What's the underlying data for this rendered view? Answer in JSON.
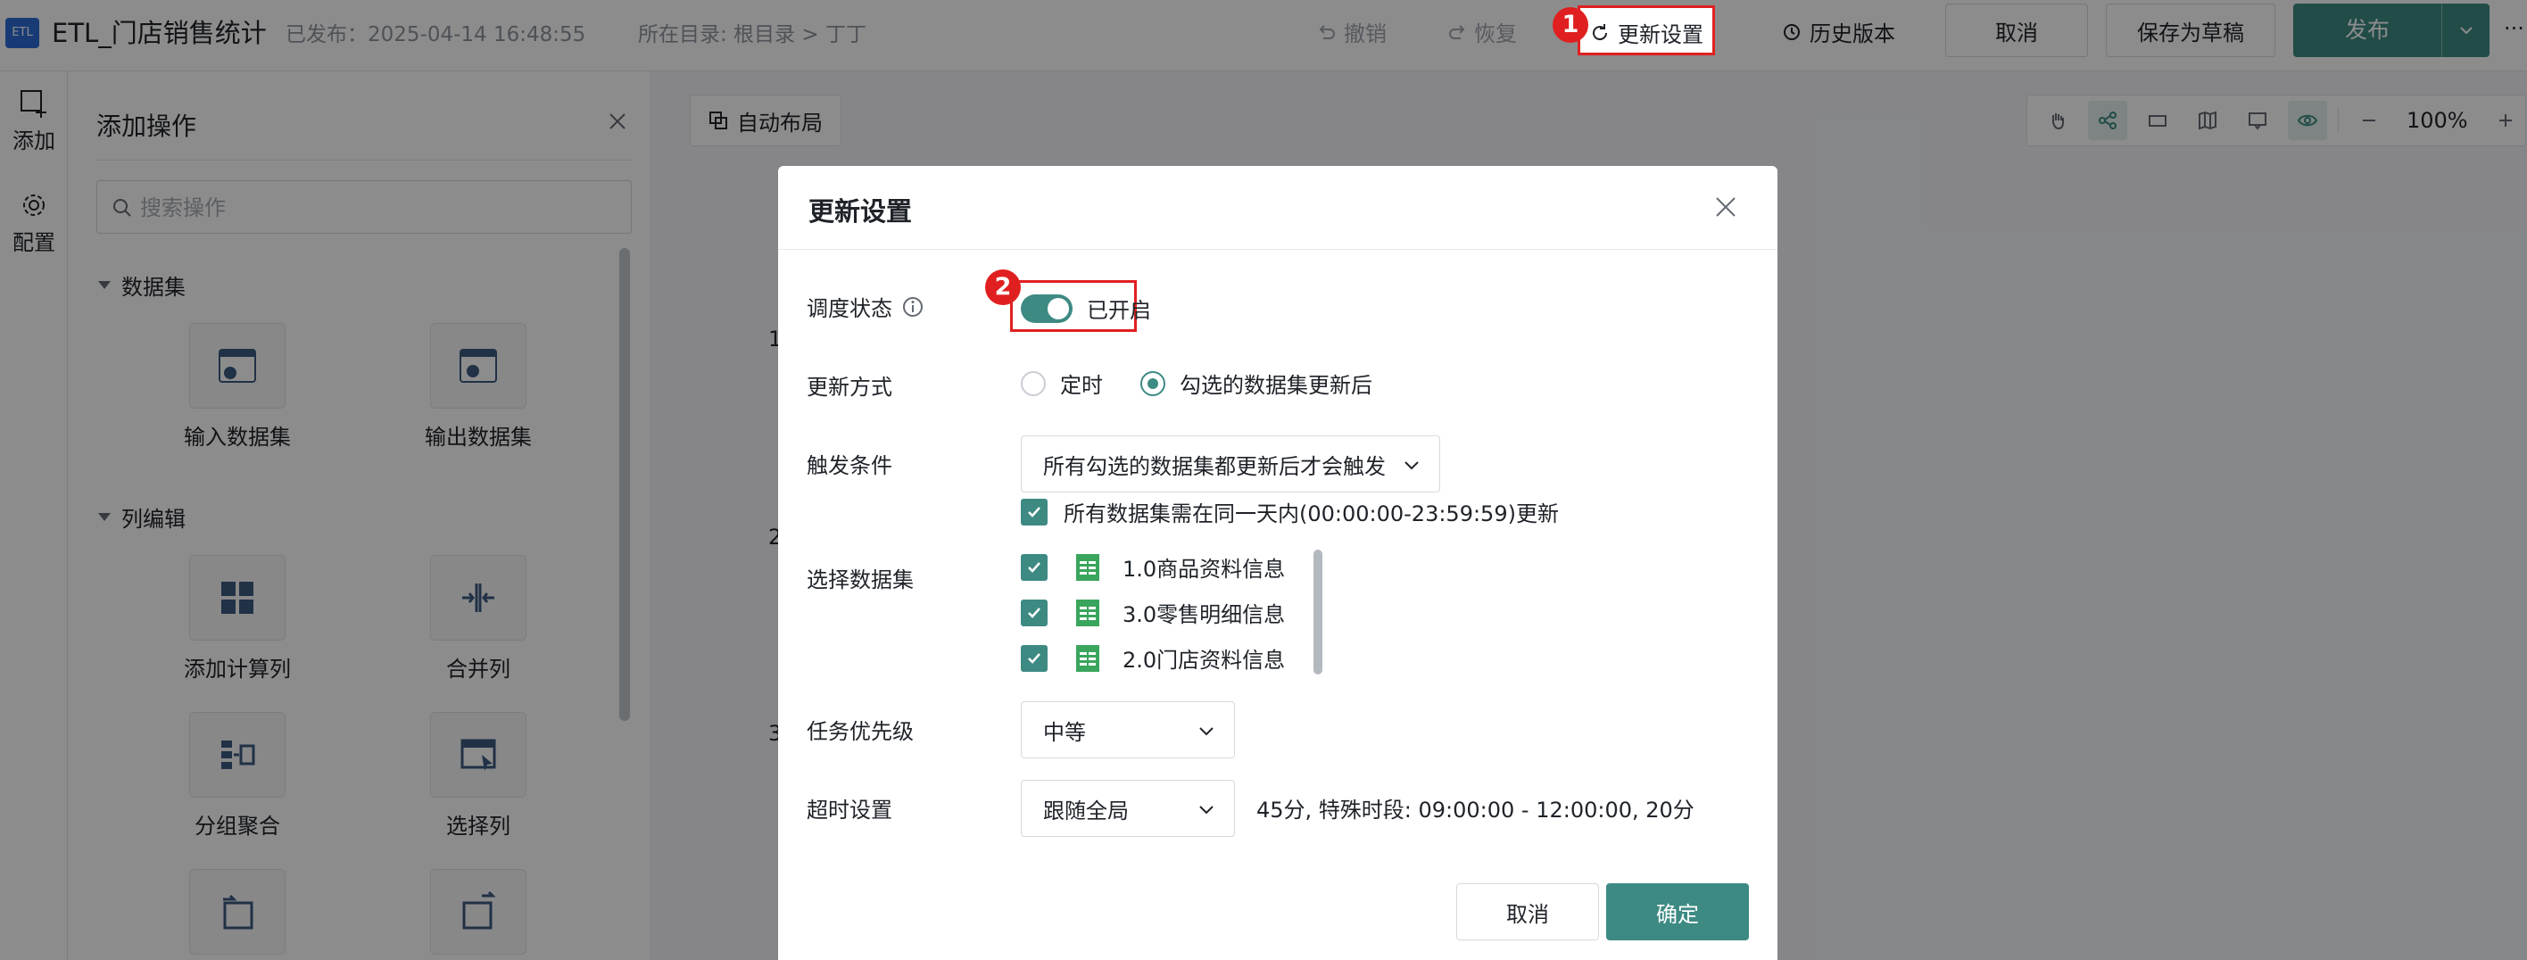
{
  "topbar": {
    "logo_text": "ETL",
    "title": "ETL_门店销售统计",
    "publish_info": "已发布：2025-04-14 16:48:55",
    "directory": "所在目录: 根目录 > 丁丁",
    "undo": "撤销",
    "redo": "恢复",
    "update_settings": "更新设置",
    "history": "历史版本",
    "cancel": "取消",
    "save_draft": "保存为草稿",
    "publish": "发布",
    "more": "···"
  },
  "callouts": [
    "1",
    "2"
  ],
  "rail": {
    "add": "添加",
    "config": "配置"
  },
  "ops_panel": {
    "title": "添加操作",
    "search_placeholder": "搜索操作",
    "sections": [
      {
        "title": "数据集",
        "items": [
          "输入数据集",
          "输出数据集"
        ]
      },
      {
        "title": "列编辑",
        "items": [
          "添加计算列",
          "合并列",
          "分组聚合",
          "选择列"
        ]
      }
    ]
  },
  "canvas": {
    "auto_layout": "自动布局",
    "zoom": "100%",
    "row_numbers": [
      "1",
      "2",
      "3"
    ]
  },
  "modal": {
    "title": "更新设置",
    "schedule_label": "调度状态",
    "schedule_value": "已开启",
    "method_label": "更新方式",
    "method_options": [
      "定时",
      "勾选的数据集更新后"
    ],
    "method_selected": "勾选的数据集更新后",
    "trigger_label": "触发条件",
    "trigger_value": "所有勾选的数据集都更新后才会触发",
    "same_day_text": "所有数据集需在同一天内(00:00:00-23:59:59)更新",
    "dataset_label": "选择数据集",
    "datasets": [
      "1.0商品资料信息",
      "3.0零售明细信息",
      "2.0门店资料信息"
    ],
    "priority_label": "任务优先级",
    "priority_value": "中等",
    "timeout_label": "超时设置",
    "timeout_value": "跟随全局",
    "timeout_note": "45分, 特殊时段: 09:00:00 - 12:00:00, 20分",
    "cancel": "取消",
    "confirm": "确定"
  },
  "colors": {
    "accent": "#3d8a83",
    "highlight": "#e02020",
    "logo": "#2c6cd6",
    "csv_icon": "#3aa55c"
  }
}
